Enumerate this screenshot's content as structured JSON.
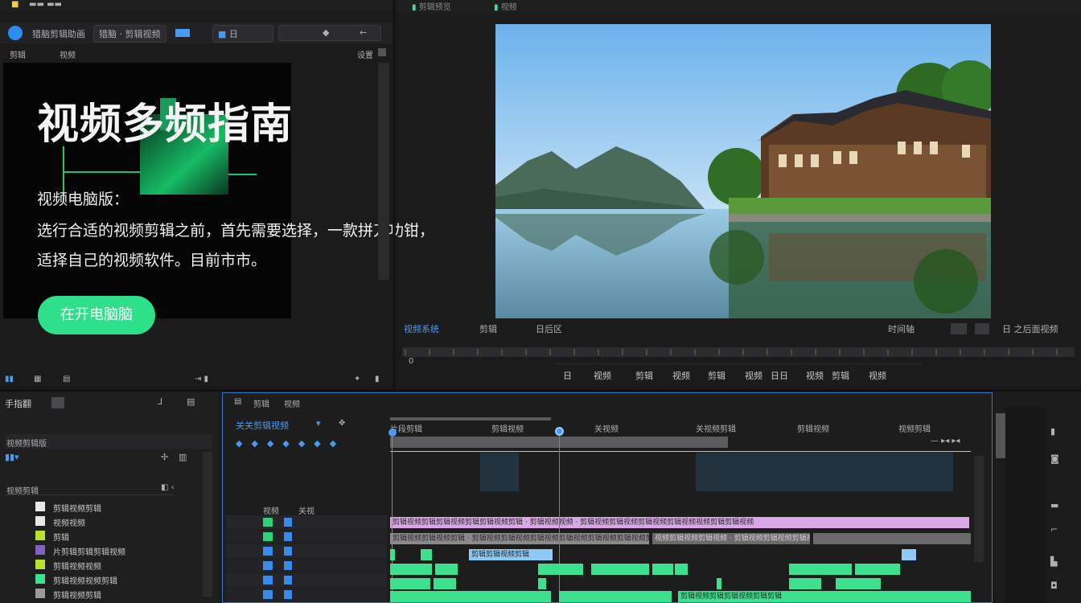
{
  "hero": {
    "title": "视频多频指南",
    "subtitle": "视频电脑版：",
    "line1": "选行合适的视频剪辑之前，首先需要选择，一款拼刀功钳，",
    "line2": "适择自己的视频软件。目前市市。",
    "cta": "在开电脑脑"
  },
  "top_toolbar": {
    "items": [
      "猎脑剪辑助画",
      "猎脑 · 剪辑视频",
      "日",
      "剪辑",
      "关"
    ],
    "left_label": "剪辑",
    "left_label2": "视频",
    "right_label": "设置"
  },
  "monitor": {
    "tabs": [
      "视频系统",
      "剪辑",
      "日后区"
    ],
    "right_tabs": [
      "时间轴",
      "日 之后面视频"
    ],
    "controls": [
      "日",
      "视频",
      "剪辑",
      "视频",
      "剪辑",
      "视频",
      "日日",
      "视频",
      "剪辑",
      "视频"
    ],
    "header_tabs": [
      "剪辑预览",
      "视频"
    ]
  },
  "project_panel": {
    "title": "手指翻",
    "section1": "视频剪辑版",
    "section2": "视频剪辑",
    "items": [
      {
        "label": "剪辑视频剪辑",
        "color": "#e8e8e8"
      },
      {
        "label": "视频视频",
        "color": "#e8e8e8"
      },
      {
        "label": "剪辑",
        "color": "#b8e030"
      },
      {
        "label": "片剪辑剪辑剪辑视频",
        "color": "#8060c0"
      },
      {
        "label": "剪辑视频视频",
        "color": "#b8e030"
      },
      {
        "label": "剪辑视频视频剪辑",
        "color": "#3de08e"
      },
      {
        "label": "剪辑视频剪辑",
        "color": "#9a9a9a"
      }
    ]
  },
  "timeline": {
    "header": [
      "剪辑",
      "视频"
    ],
    "sequence_name": "关关剪辑视频",
    "ruler_labels": [
      "片段剪辑",
      "剪辑视频",
      "关视频",
      "关视频剪辑",
      "剪辑视频",
      "视频剪辑"
    ],
    "track_labels": [
      "视频",
      "关视"
    ],
    "clip_text_pink": "剪辑视频剪辑剪辑视频剪辑剪辑视频剪辑 · 剪辑视频视频 · 剪辑视频剪辑视频剪辑视频剪辑视频视频剪辑剪辑视频",
    "clip_text_gray1": "剪辑视频剪辑视频剪辑 · 剪辑视频剪辑视频剪辑视频剪辑视频剪辑视频剪辑视频剪辑视频",
    "clip_text_gray2": "视频剪辑视频剪辑视频 · 剪辑视频剪辑视频剪辑视频剪辑视频",
    "clip_text_blue": "剪辑剪辑视频剪辑",
    "clip_text_green": "剪辑视频剪辑剪辑视频剪辑剪辑"
  },
  "colors": {
    "accent_green": "#3de08e",
    "accent_blue": "#4a9bf0",
    "playhead": "#e040c0",
    "clip_pink": "#d9a6e6",
    "clip_blue": "#8ec8f5"
  }
}
